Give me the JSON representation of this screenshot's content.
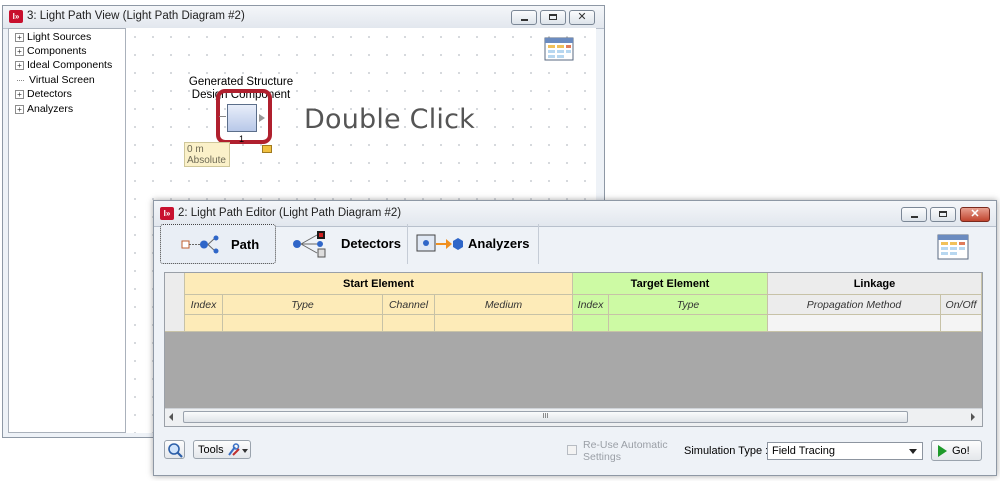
{
  "view_window": {
    "title": "3: Light Path View (Light Path Diagram #2)",
    "tree": [
      {
        "label": "Light Sources",
        "expandable": true
      },
      {
        "label": "Components",
        "expandable": true
      },
      {
        "label": "Ideal Components",
        "expandable": true
      },
      {
        "label": "Virtual Screen",
        "expandable": false
      },
      {
        "label": "Detectors",
        "expandable": true
      },
      {
        "label": "Analyzers",
        "expandable": true
      }
    ],
    "component": {
      "label_line1": "Generated Structure",
      "label_line2": "Design Component",
      "index": "1",
      "position_value": "0 m",
      "position_mode": "Absolute"
    },
    "hint": "Double Click"
  },
  "editor_window": {
    "title": "2: Light Path Editor (Light Path Diagram #2)",
    "tabs": [
      {
        "label": "Path",
        "active": true
      },
      {
        "label": "Detectors",
        "active": false
      },
      {
        "label": "Analyzers",
        "active": false
      }
    ],
    "table": {
      "groups": {
        "start": "Start Element",
        "target": "Target Element",
        "linkage": "Linkage"
      },
      "columns": {
        "start_index": "Index",
        "start_type": "Type",
        "channel": "Channel",
        "medium": "Medium",
        "target_index": "Index",
        "target_type": "Type",
        "propagation": "Propagation Method",
        "onoff": "On/Off"
      },
      "scroll_grip": "III"
    },
    "bottom": {
      "tools_label": "Tools",
      "reuse_line1": "Re-Use  Automatic",
      "reuse_line2": "Settings",
      "sim_type_label": "Simulation Type :",
      "sim_type_value": "Field Tracing",
      "go_label": "Go!"
    }
  },
  "colors": {
    "highlight": "#b0202e",
    "start_header": "#fdebb8",
    "target_header": "#cdfaa4",
    "go_arrow": "#1f9a2a"
  }
}
